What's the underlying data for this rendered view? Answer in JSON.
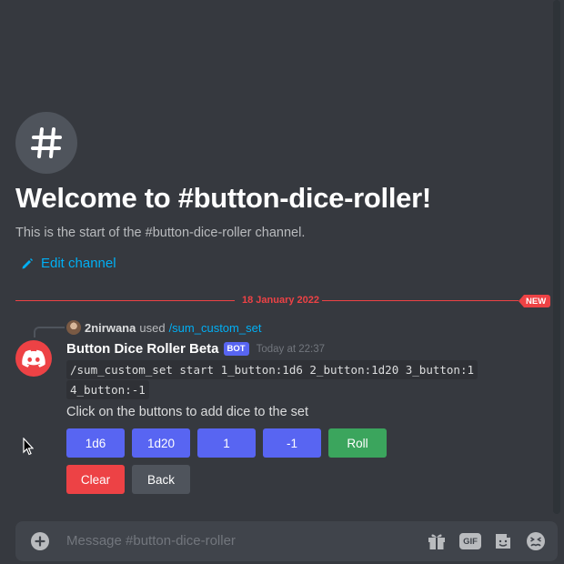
{
  "channel": {
    "welcome_title": "Welcome to #button-dice-roller!",
    "welcome_subtitle": "This is the start of the #button-dice-roller channel.",
    "edit_label": "Edit channel"
  },
  "divider": {
    "date": "18 January 2022",
    "new_badge": "NEW"
  },
  "reply": {
    "username": "2nirwana",
    "used": "used",
    "command": "/sum_custom_set"
  },
  "message": {
    "author": "Button Dice Roller Beta",
    "tag": "BOT",
    "timestamp": "Today at 22:37",
    "code_line_1": "/sum_custom_set start 1_button:1d6 2_button:1d20 3_button:1",
    "code_line_2": "4_button:-1",
    "instruction": "Click on the buttons to add dice to the set",
    "buttons_row1": [
      "1d6",
      "1d20",
      "1",
      "-1",
      "Roll"
    ],
    "buttons_row2": [
      "Clear",
      "Back"
    ]
  },
  "composer": {
    "placeholder": "Message #button-dice-roller"
  },
  "colors": {
    "background": "#36393f",
    "blurple": "#5865f2",
    "green": "#3ba55d",
    "red": "#ed4245",
    "grey": "#4f545c",
    "link": "#00aff4"
  },
  "icons": [
    "hash-icon",
    "pencil-icon",
    "discord-logo-icon",
    "plus-icon",
    "gift-icon",
    "gif-icon",
    "sticker-icon",
    "emoji-icon",
    "mouse-cursor-icon"
  ]
}
